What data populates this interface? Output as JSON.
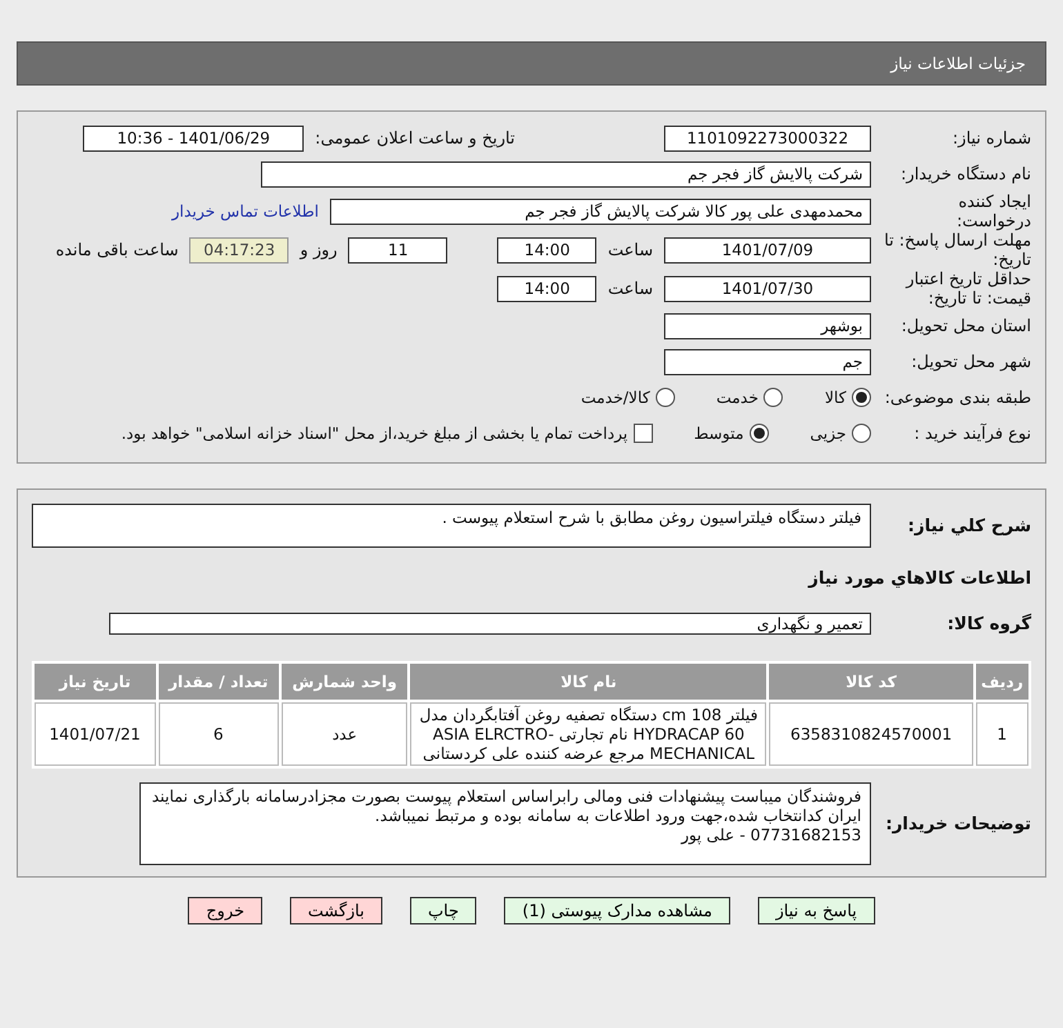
{
  "header": {
    "title": "جزئیات اطلاعات نیاز"
  },
  "need_number": {
    "label": "شماره نیاز:",
    "value": "1101092273000322"
  },
  "announce": {
    "label": "تاریخ و ساعت اعلان عمومی:",
    "value": "1401/06/29 - 10:36"
  },
  "buyer_org": {
    "label": "نام دستگاه خریدار:",
    "value": "شرکت پالایش گاز فجر جم"
  },
  "requester": {
    "label": "ایجاد کننده درخواست:",
    "value": "محمدمهدی علی پور کالا شرکت پالایش گاز فجر جم",
    "link": "اطلاعات تماس خریدار"
  },
  "deadline": {
    "label": "مهلت ارسال پاسخ: تا تاریخ:",
    "date": "1401/07/09",
    "time_label": "ساعت",
    "time": "14:00",
    "days": "11",
    "days_label": "روز و",
    "remaining": "04:17:23",
    "remaining_label": "ساعت باقی مانده"
  },
  "validity": {
    "label": "حداقل تاریخ اعتبار قیمت: تا تاریخ:",
    "date": "1401/07/30",
    "time_label": "ساعت",
    "time": "14:00"
  },
  "province": {
    "label": "استان محل تحویل:",
    "value": "بوشهر"
  },
  "city": {
    "label": "شهر محل تحویل:",
    "value": "جم"
  },
  "category": {
    "label": "طبقه بندی موضوعی:",
    "options": [
      {
        "label": "کالا",
        "selected": true
      },
      {
        "label": "خدمت",
        "selected": false
      },
      {
        "label": "کالا/خدمت",
        "selected": false
      }
    ]
  },
  "process": {
    "label": "نوع فرآیند خرید :",
    "options": [
      {
        "label": "جزیی",
        "selected": false
      },
      {
        "label": "متوسط",
        "selected": true
      }
    ],
    "payment": {
      "checked": false,
      "text": "پرداخت تمام یا بخشی از مبلغ خرید،از محل \"اسناد خزانه اسلامی\" خواهد بود."
    }
  },
  "description": {
    "label": "شرح كلي نياز:",
    "value": "فیلتر دستگاه فیلتراسیون روغن مطابق با شرح استعلام پیوست ."
  },
  "goods_title": "اطلاعات كالاهاي مورد نياز",
  "goods_group": {
    "label": "گروه کالا:",
    "value": "تعمیر و نگهداری"
  },
  "table": {
    "columns": [
      "ردیف",
      "کد کالا",
      "نام کالا",
      "واحد شمارش",
      "تعداد / مقدار",
      "تاریخ نیاز"
    ],
    "rows": [
      [
        "1",
        "6358310824570001",
        "فیلتر 108 cm دستگاه تصفیه روغن آفتابگردان مدل HYDRACAP 60 نام تجارتی ASIA ELRCTRO-MECHANICAL مرجع عرضه کننده علی کردستانی",
        "عدد",
        "6",
        "1401/07/21"
      ]
    ]
  },
  "buyer_notes": {
    "label": "توضیحات خریدار:",
    "lines": [
      "فروشندگان میباست پیشنهادات فنی ومالی رابراساس استعلام پیوست بصورت مجزادرسامانه بارگذاری نمایند ایران کدانتخاب شده،جهت ورود اطلاعات به سامانه بوده و مرتبط نمیباشد.",
      "07731682153 - علی پور"
    ]
  },
  "buttons": [
    {
      "label": "پاسخ به نیاز",
      "kind": "action"
    },
    {
      "label": "مشاهده مدارک پیوستی (1)",
      "kind": "action"
    },
    {
      "label": "چاپ",
      "kind": "action"
    },
    {
      "label": "بازگشت",
      "kind": "exit"
    },
    {
      "label": "خروج",
      "kind": "exit"
    }
  ]
}
